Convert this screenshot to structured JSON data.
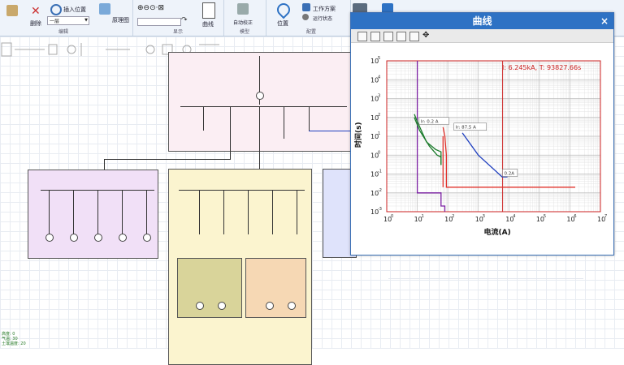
{
  "toolbar": {
    "groups": [
      {
        "caption": "编辑"
      },
      {
        "caption": "显示"
      },
      {
        "caption": "模型"
      },
      {
        "caption": "配置"
      }
    ],
    "delete_label": "删除",
    "insert_position_label": "插入位置",
    "level_select_value": "一层",
    "schematic_label": "原理图",
    "curve_label": "曲线",
    "auto_settle_label": "自动校正",
    "position_label": "位置",
    "work_plan_label": "工作方案",
    "run_status_label": "运行状态"
  },
  "status": {
    "line1": "高度: 0",
    "line2": "气温: 30",
    "line3": "土壤温度: 20"
  },
  "chart_window": {
    "title": "曲线",
    "close_glyph": "×"
  },
  "chart_data": {
    "type": "line",
    "annotation": "I: 6.245kA, T: 93827.66s",
    "xlabel": "电流(A)",
    "ylabel": "时间(s)",
    "x_scale": "log",
    "y_scale": "log",
    "xlim": [
      1,
      10000000
    ],
    "ylim": [
      0.001,
      100000
    ],
    "x_ticks": [
      {
        "base": "10",
        "exp": "0",
        "v": 1
      },
      {
        "base": "10",
        "exp": "1",
        "v": 10
      },
      {
        "base": "10",
        "exp": "2",
        "v": 100
      },
      {
        "base": "10",
        "exp": "3",
        "v": 1000
      },
      {
        "base": "10",
        "exp": "4",
        "v": 10000
      },
      {
        "base": "10",
        "exp": "5",
        "v": 100000
      },
      {
        "base": "10",
        "exp": "6",
        "v": 1000000
      },
      {
        "base": "10",
        "exp": "7",
        "v": 10000000
      }
    ],
    "y_ticks": [
      {
        "base": "10",
        "exp": "-3",
        "v": 0.001
      },
      {
        "base": "10",
        "exp": "-2",
        "v": 0.01
      },
      {
        "base": "10",
        "exp": "-1",
        "v": 0.1
      },
      {
        "base": "10",
        "exp": "0",
        "v": 1
      },
      {
        "base": "10",
        "exp": "1",
        "v": 10
      },
      {
        "base": "10",
        "exp": "2",
        "v": 100
      },
      {
        "base": "10",
        "exp": "3",
        "v": 1000
      },
      {
        "base": "10",
        "exp": "4",
        "v": 10000
      },
      {
        "base": "10",
        "exp": "5",
        "v": 100000
      }
    ],
    "grid": true,
    "cursor_x": 6245,
    "colors": {
      "purple": "#7a1fa2",
      "green": "#1a7a2a",
      "red": "#e0302a",
      "blue": "#1f3fbf",
      "cursor": "#cc2222",
      "frame": "#cc2222"
    },
    "series": [
      {
        "color": "purple",
        "points": [
          [
            10,
            100000
          ],
          [
            10,
            0.01
          ],
          [
            60,
            0.01
          ],
          [
            60,
            0.002
          ],
          [
            80,
            0.002
          ],
          [
            80,
            0.001
          ]
        ]
      },
      {
        "color": "green",
        "points": [
          [
            8,
            150
          ],
          [
            10,
            60
          ],
          [
            20,
            5
          ],
          [
            40,
            2
          ],
          [
            60,
            1.5
          ],
          [
            60,
            0.3
          ]
        ]
      },
      {
        "color": "green",
        "points": [
          [
            8,
            100
          ],
          [
            12,
            20
          ],
          [
            25,
            3
          ],
          [
            45,
            1
          ],
          [
            60,
            0.8
          ],
          [
            60,
            0.3
          ]
        ]
      },
      {
        "color": "red",
        "points": [
          [
            70,
            30
          ],
          [
            80,
            10
          ],
          [
            90,
            1
          ],
          [
            90,
            0.02
          ],
          [
            100000,
            0.02
          ],
          [
            1500000,
            0.02
          ]
        ]
      },
      {
        "color": "red",
        "points": [
          [
            70,
            10
          ],
          [
            70,
            0.02
          ]
        ]
      },
      {
        "color": "blue",
        "points": [
          [
            300,
            15
          ],
          [
            1000,
            1
          ],
          [
            6000,
            0.07
          ],
          [
            9000,
            0.07
          ]
        ]
      }
    ],
    "labels": [
      {
        "text": "Ir: 0.2 A",
        "x": 13,
        "y": 50
      },
      {
        "text": "Ir: 87.5 A",
        "x": 180,
        "y": 25
      },
      {
        "text": "0.2A",
        "x": 7000,
        "y": 0.09
      }
    ]
  }
}
